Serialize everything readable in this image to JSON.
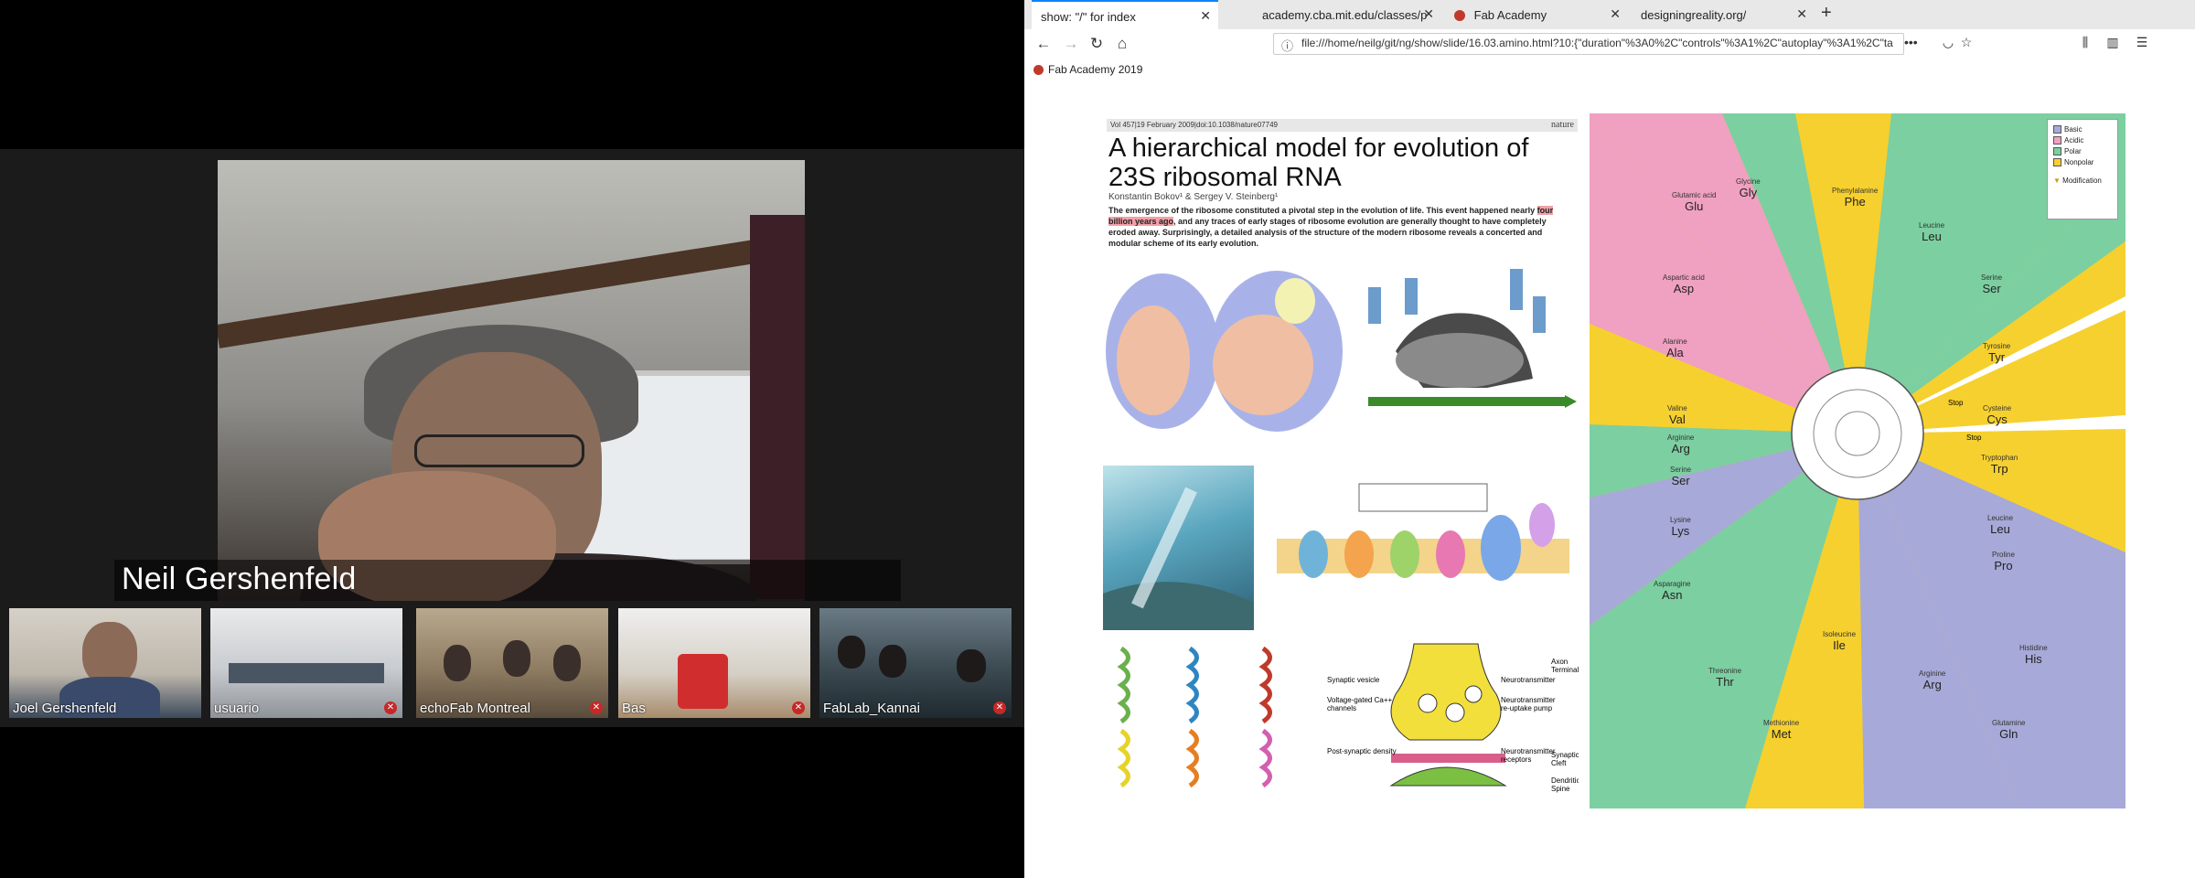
{
  "conference": {
    "active_speaker": "Neil Gershenfeld",
    "participants": [
      {
        "name": "Joel Gershenfeld"
      },
      {
        "name": "usuario"
      },
      {
        "name": "echoFab Montreal"
      },
      {
        "name": "Bas"
      },
      {
        "name": "FabLab_Kannai"
      }
    ]
  },
  "browser": {
    "tabs": [
      {
        "label": "show: \"/\" for index"
      },
      {
        "label": "academy.cba.mit.edu/classes/pr..."
      },
      {
        "label": "Fab Academy"
      },
      {
        "label": "designingreality.org/"
      }
    ],
    "url": "file:///home/neilg/git/ng/show/slide/16.03.amino.html?10:{\"duration\"%3A0%2C\"controls\"%3A1%2C\"autoplay\"%3A1%2C\"ta",
    "bookmark": "Fab Academy 2019"
  },
  "slide": {
    "paper": {
      "meta": "Vol 457|19 February 2009|doi:10.1038/nature07749",
      "journal": "nature",
      "title": "A hierarchical model for evolution of 23S ribosomal RNA",
      "authors": "Konstantin Bokov¹ & Sergey V. Steinberg¹",
      "abstract_pre": "The emergence of the ribosome constituted a pivotal step in the evolution of life. This event happened nearly ",
      "abstract_hl": "four billion years ago",
      "abstract_post": ", and any traces of early stages of ribosome evolution are generally thought to have completely eroded away. Surprisingly, a detailed analysis of the structure of the modern ribosome reveals a concerted and modular scheme of its early evolution.",
      "synapse_labels": {
        "vesicle": "Synaptic vesicle",
        "channels": "Voltage-gated Ca++ channels",
        "density": "Post-synaptic density",
        "neurotransmitter": "Neurotransmitter",
        "reuptake": "Neurotransmitter re-uptake pump",
        "receptors": "Neurotransmitter receptors",
        "axon": "Axon Terminal",
        "cleft": "Synaptic Cleft",
        "spine": "Dendritic Spine"
      }
    },
    "codon_wheel": {
      "legend": {
        "basic": "Basic",
        "acidic": "Acidic",
        "polar": "Polar",
        "nonpolar": "Nonpolar",
        "modification": "Modification"
      },
      "amino_acids": [
        {
          "name": "Glutamic acid",
          "abbr": "Glu"
        },
        {
          "name": "Glycine",
          "abbr": "Gly"
        },
        {
          "name": "Phenylalanine",
          "abbr": "Phe"
        },
        {
          "name": "Leucine",
          "abbr": "Leu"
        },
        {
          "name": "Aspartic acid",
          "abbr": "Asp"
        },
        {
          "name": "Serine",
          "abbr": "Ser"
        },
        {
          "name": "Alanine",
          "abbr": "Ala"
        },
        {
          "name": "Tyrosine",
          "abbr": "Tyr"
        },
        {
          "name": "Valine",
          "abbr": "Val"
        },
        {
          "name": "Cysteine",
          "abbr": "Cys"
        },
        {
          "name": "Arginine",
          "abbr": "Arg"
        },
        {
          "name": "Tryptophan",
          "abbr": "Trp"
        },
        {
          "name": "Serine",
          "abbr": "Ser"
        },
        {
          "name": "Leucine",
          "abbr": "Leu"
        },
        {
          "name": "Lysine",
          "abbr": "Lys"
        },
        {
          "name": "Proline",
          "abbr": "Pro"
        },
        {
          "name": "Asparagine",
          "abbr": "Asn"
        },
        {
          "name": "Isoleucine",
          "abbr": "Ile"
        },
        {
          "name": "Histidine",
          "abbr": "His"
        },
        {
          "name": "Threonine",
          "abbr": "Thr"
        },
        {
          "name": "Arginine",
          "abbr": "Arg"
        },
        {
          "name": "Methionine",
          "abbr": "Met"
        },
        {
          "name": "Glutamine",
          "abbr": "Gln"
        }
      ],
      "stop1": "Stop",
      "stop2": "Stop"
    }
  }
}
